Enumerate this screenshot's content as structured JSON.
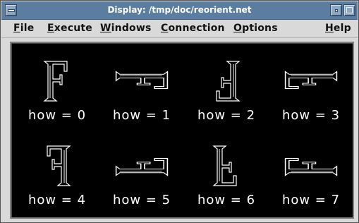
{
  "window": {
    "title": "Display: /tmp/doc/reorient.net"
  },
  "menubar": {
    "file": {
      "ul": "F",
      "rest": "ile"
    },
    "execute": {
      "pre": "",
      "ul": "E",
      "rest": "xecute"
    },
    "windows": {
      "ul": "W",
      "rest": "indows"
    },
    "connection": {
      "ul": "C",
      "rest": "onnection"
    },
    "options": {
      "ul": "O",
      "rest": "ptions"
    },
    "help": {
      "ul": "H",
      "rest": "elp"
    }
  },
  "cells": [
    {
      "label": "how = 0",
      "glyph": "F",
      "how": 0
    },
    {
      "label": "how = 1",
      "glyph": "F",
      "how": 1
    },
    {
      "label": "how = 2",
      "glyph": "F",
      "how": 2
    },
    {
      "label": "how = 3",
      "glyph": "F",
      "how": 3
    },
    {
      "label": "how = 4",
      "glyph": "F",
      "how": 4
    },
    {
      "label": "how = 5",
      "glyph": "F",
      "how": 5
    },
    {
      "label": "how = 6",
      "glyph": "F",
      "how": 6
    },
    {
      "label": "how = 7",
      "glyph": "F",
      "how": 7
    }
  ],
  "colors": {
    "canvas": "#000000",
    "glyph": "#ffffff",
    "titlebar": "#5b7ea0"
  }
}
